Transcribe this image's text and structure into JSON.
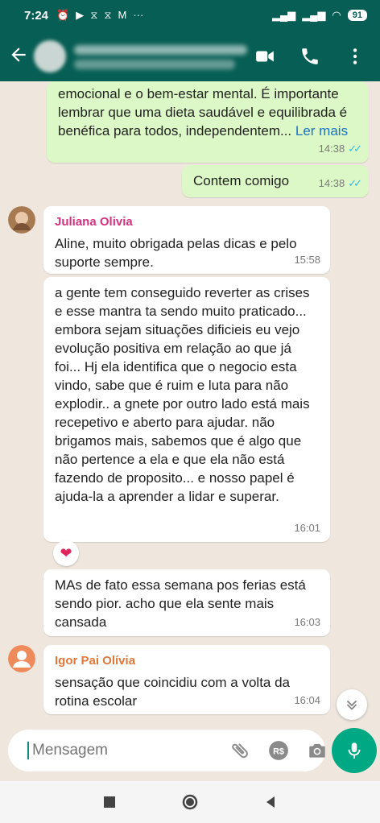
{
  "status": {
    "time": "7:24",
    "battery": "91"
  },
  "colors": {
    "header": "#075e54",
    "outgoing": "#dcf8c6",
    "incoming": "#ffffff",
    "accent": "#00a884",
    "sender_1": "#d6317f",
    "sender_2": "#e0783c"
  },
  "messages": [
    {
      "text": "emocional e o bem-estar mental. É importante lembrar que uma dieta saudável e equilibrada é benéfica para todos, independentem...",
      "read_more": "Ler mais",
      "time": "14:38",
      "status_icon": "double-check-icon"
    },
    {
      "text": "Contem comigo",
      "time": "14:38",
      "status_icon": "double-check-icon"
    },
    {
      "sender": "Juliana Olivia",
      "text": "Aline, muito obrigada pelas dicas e pelo suporte sempre.",
      "time": "15:58"
    },
    {
      "text": "a gente tem conseguido reverter as crises e esse mantra ta sendo muito praticado... embora sejam situações dificieis eu vejo evolução positiva em relação ao que já foi... Hj ela identifica que o negocio esta vindo, sabe que é ruim e luta para não explodir.. a gnete por outro lado está mais recepetivo e aberto para ajudar. não brigamos mais, sabemos que é algo que não pertence a ela e que ela não está fazendo de proposito... e nosso papel é ajuda-la a aprender a lidar e superar.",
      "time": "16:01",
      "reaction": "❤"
    },
    {
      "text": "MAs de fato essa semana pos ferias está sendo pior. acho que ela sente mais cansada",
      "time": "16:03"
    },
    {
      "sender": "Igor Pai Olívia",
      "text": "sensação que coincidiu com a volta da rotina escolar",
      "time": "16:04"
    }
  ],
  "composer": {
    "placeholder": "Mensagem"
  }
}
